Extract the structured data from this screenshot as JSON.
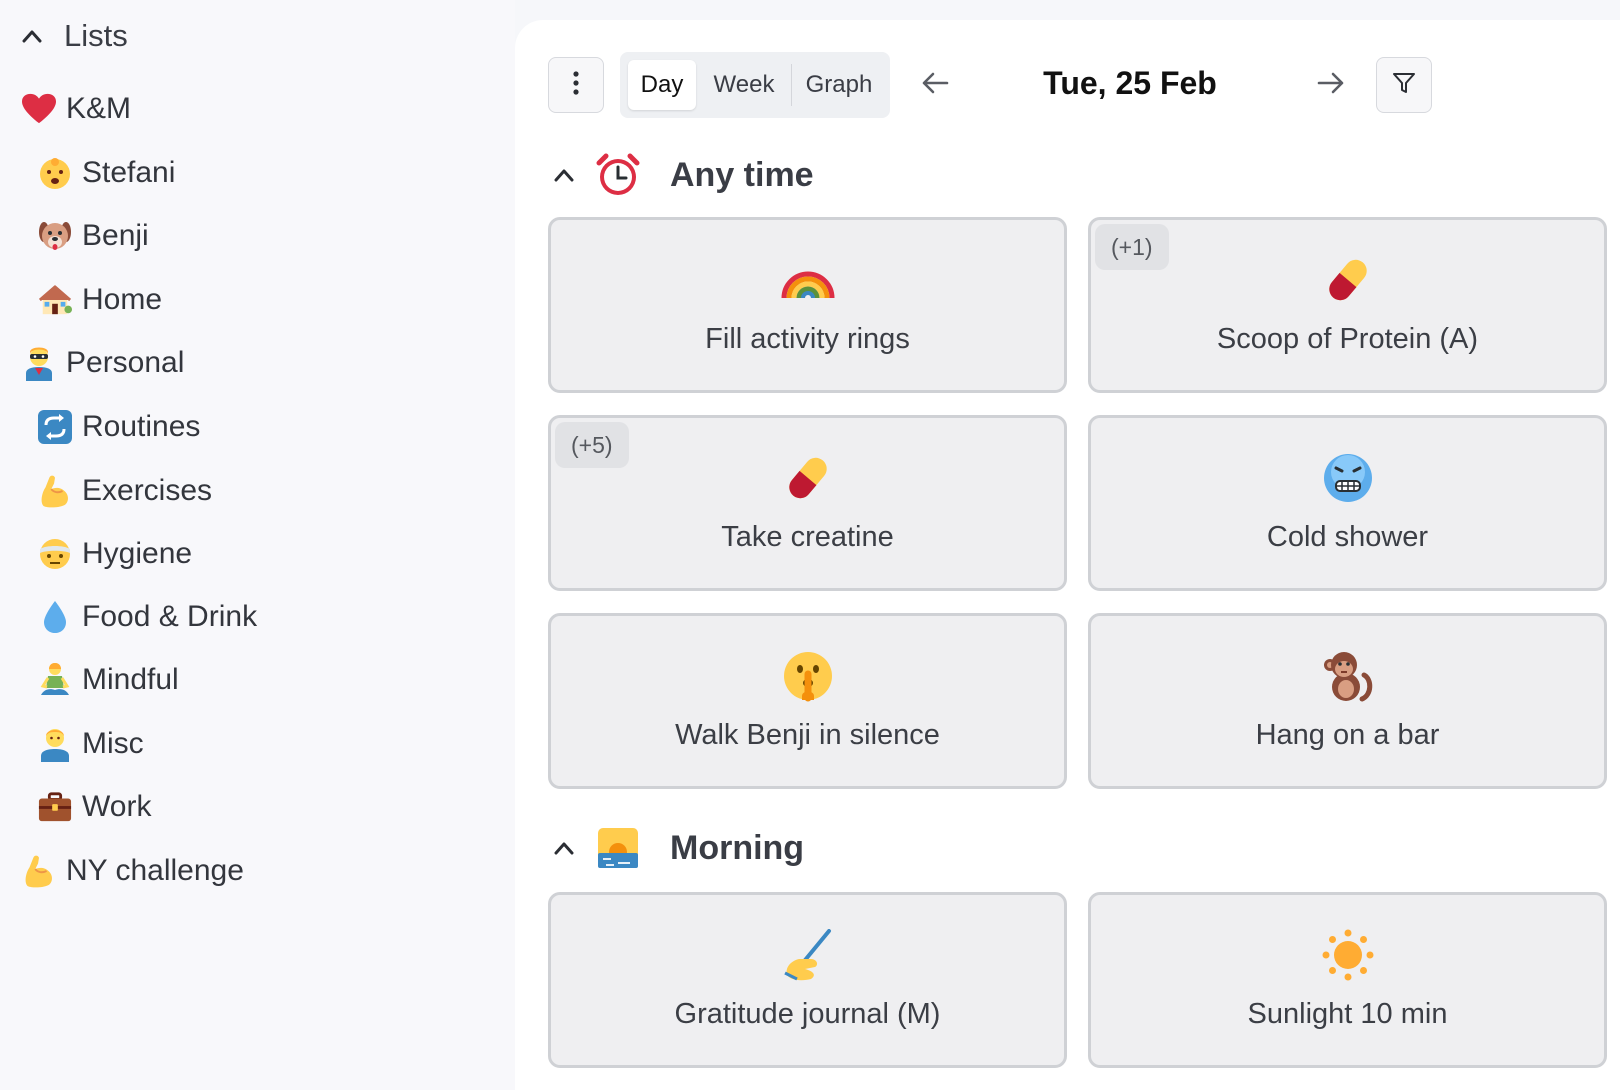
{
  "sidebar": {
    "header": {
      "title": "Lists"
    },
    "items": [
      {
        "label": "K&M",
        "icon": "heart-icon",
        "level": 0
      },
      {
        "label": "Stefani",
        "icon": "baby-icon",
        "level": 1
      },
      {
        "label": "Benji",
        "icon": "dog-face-icon",
        "level": 1
      },
      {
        "label": "Home",
        "icon": "house-icon",
        "level": 1
      },
      {
        "label": "Personal",
        "icon": "superhero-icon",
        "level": 0
      },
      {
        "label": "Routines",
        "icon": "repeat-icon",
        "level": 1
      },
      {
        "label": "Exercises",
        "icon": "flexed-biceps-icon",
        "level": 1
      },
      {
        "label": "Hygiene",
        "icon": "face-with-bandage-icon",
        "level": 1
      },
      {
        "label": "Food & Drink",
        "icon": "droplet-icon",
        "level": 1
      },
      {
        "label": "Mindful",
        "icon": "lotus-position-icon",
        "level": 1
      },
      {
        "label": "Misc",
        "icon": "person-icon",
        "level": 1
      },
      {
        "label": "Work",
        "icon": "briefcase-icon",
        "level": 1
      },
      {
        "label": "NY challenge",
        "icon": "flexed-biceps-icon",
        "level": 0
      }
    ]
  },
  "toolbar": {
    "more_icon": "vertical-ellipsis-icon",
    "view_tabs": [
      {
        "label": "Day",
        "active": true
      },
      {
        "label": "Week",
        "active": false
      },
      {
        "label": "Graph",
        "active": false
      }
    ],
    "prev_icon": "arrow-left-icon",
    "date": "Tue, 25 Feb",
    "next_icon": "arrow-right-icon",
    "filter_icon": "filter-icon"
  },
  "sections": [
    {
      "title": "Any time",
      "icon": "alarm-clock-icon",
      "cards": [
        {
          "label": "Fill activity rings",
          "icon": "rainbow-icon",
          "badge": ""
        },
        {
          "label": "Scoop of Protein (A)",
          "icon": "pill-icon",
          "badge": "(+1)"
        },
        {
          "label": "Take creatine",
          "icon": "pill-icon",
          "badge": "(+5)"
        },
        {
          "label": "Cold shower",
          "icon": "cold-face-icon",
          "badge": ""
        },
        {
          "label": "Walk Benji in silence",
          "icon": "shushing-face-icon",
          "badge": ""
        },
        {
          "label": "Hang on a bar",
          "icon": "monkey-icon",
          "badge": ""
        }
      ]
    },
    {
      "title": "Morning",
      "icon": "sunrise-icon",
      "cards": [
        {
          "label": "Gratitude journal (M)",
          "icon": "writing-hand-icon",
          "badge": ""
        },
        {
          "label": "Sunlight 10 min",
          "icon": "sun-icon",
          "badge": ""
        }
      ]
    }
  ],
  "colors": {
    "sidebar_bg": "#f8f8fb",
    "main_bg": "#ffffff",
    "card_bg": "#efeff1",
    "card_border": "#cfd1d5",
    "badge_bg": "#e1e2e5",
    "text": "#3a3d45"
  }
}
